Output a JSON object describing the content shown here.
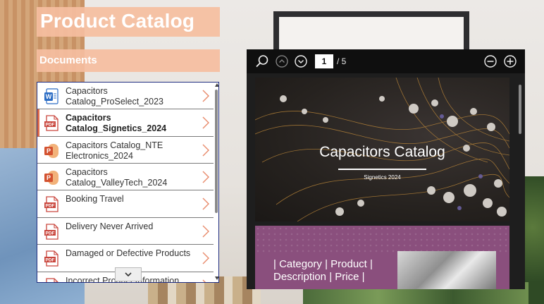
{
  "app": {
    "title": "Product Catalog"
  },
  "sidebar": {
    "heading": "Documents",
    "items": [
      {
        "label": "Capacitors Catalog_ProSelect_2023",
        "type": "word",
        "selected": false
      },
      {
        "label": "Capacitors Catalog_Signetics_2024",
        "type": "pdf",
        "selected": true
      },
      {
        "label": "Capacitors Catalog_NTE Electronics_2024",
        "type": "powerpoint",
        "selected": false
      },
      {
        "label": "Capacitors Catalog_ValleyTech_2024",
        "type": "powerpoint",
        "selected": false
      },
      {
        "label": "Booking Travel",
        "type": "pdf",
        "selected": false
      },
      {
        "label": "Delivery Never Arrived",
        "type": "pdf",
        "selected": false
      },
      {
        "label": "Damaged or Defective Products",
        "type": "pdf",
        "selected": false
      },
      {
        "label": "Incorrect Product Information",
        "type": "pdf",
        "selected": false
      }
    ]
  },
  "viewer": {
    "current_page": "1",
    "page_total": "/ 5",
    "cover_title": "Capacitors Catalog",
    "cover_subtitle": "Signetics 2024",
    "page2_text": "| Category | Product | Description | Price |"
  },
  "colors": {
    "accent_peach": "#f5bea0",
    "list_border": "#1f2d80",
    "chevron": "#e88a6a",
    "pdf_red": "#c9463d",
    "word_blue": "#2b6cc4",
    "ppt_orange": "#d35230",
    "viewer_bg": "#1e1e1e"
  },
  "icons": {
    "search": "search-icon",
    "prev_page": "chevron-up-circle-icon",
    "next_page": "chevron-down-circle-icon",
    "zoom_out": "zoom-out-icon",
    "zoom_in": "zoom-in-icon"
  }
}
